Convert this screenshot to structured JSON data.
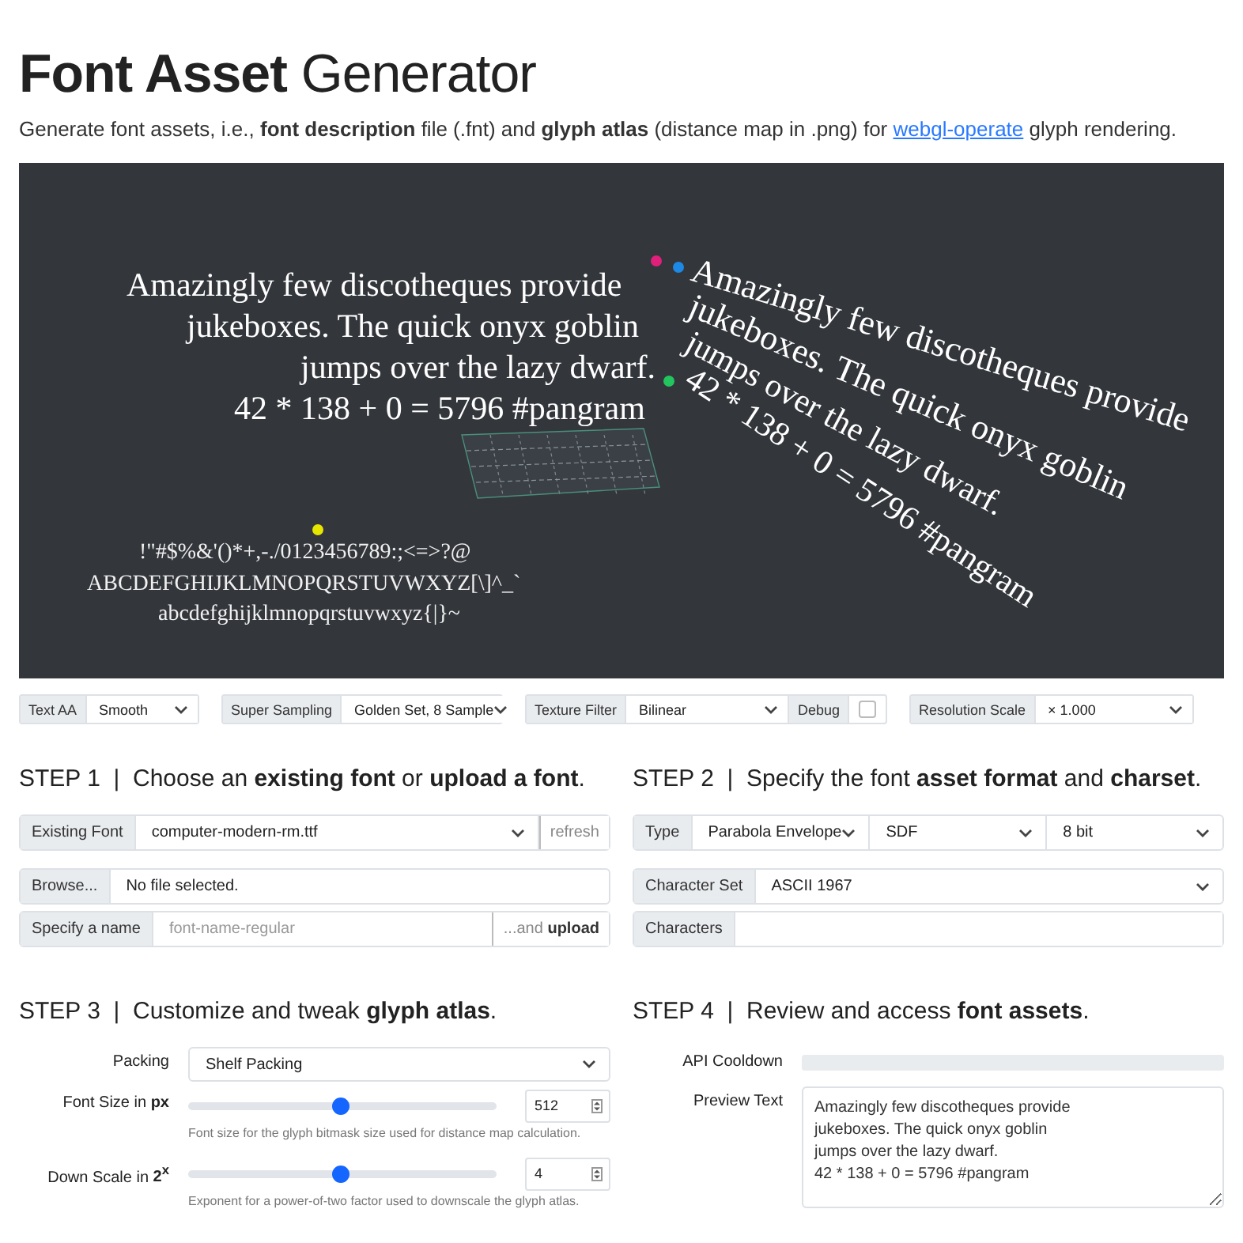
{
  "title": {
    "bold": "Font Asset",
    "light": "Generator"
  },
  "intro": {
    "text": "Generate font assets, i.e., **font description** file (.fnt) and **glyph atlas** (distance map in .png) for",
    "link": "webgl-operate",
    "after": "glyph rendering."
  },
  "render": {
    "left_lines": [
      "Amazingly few discotheques provide",
      "jukeboxes. The quick onyx goblin",
      "jumps over the lazy dwarf.",
      "42 * 138 + 0 = 5796 #pangram"
    ],
    "glyph_lines": [
      "!\"#$%&'()*+,-./0123456789:;<=>?@",
      "ABCDEFGHIJKLMNOPQRSTUVWXYZ[\\]^_`",
      "abcdefghijklmnopqrstuvwxyz{|}~"
    ],
    "right_lines": [
      "Amazingly few discotheques provide",
      "jukeboxes. The quick onyx goblin",
      "jumps over the lazy dwarf.",
      "42 * 138 + 0 = 5796 #pangram"
    ]
  },
  "render_controls": [
    {
      "controls": [
        {
          "kind": "select",
          "label": "Text AA",
          "value": "Smooth"
        }
      ]
    },
    {
      "controls": [
        {
          "kind": "select",
          "label": "Super Sampling",
          "value": "Golden Set, 8 Sample"
        }
      ]
    },
    {
      "controls": [
        {
          "kind": "select",
          "label": "Texture Filter",
          "value": "Bilinear"
        },
        {
          "kind": "checkbox",
          "label": "Debug",
          "checked": false
        }
      ]
    },
    {
      "controls": [
        {
          "kind": "select",
          "label": "Resolution Scale",
          "value": "× 1.000"
        }
      ]
    }
  ],
  "step1": {
    "heading": "STEP 1  |  Choose an **existing font** or **upload a font**.",
    "font_label": "Existing Font",
    "font_value": "computer-modern-rm.ttf",
    "refresh": "refresh",
    "browse": "Browse...",
    "file_status": "No file selected.",
    "name_label": "Specify a name",
    "name_placeholder": "font-name-regular",
    "upload": "...and **upload**"
  },
  "step2": {
    "heading": "STEP 2  |  Specify the font **asset format** and **charset**.",
    "type_label": "Type",
    "type_selects": [
      "Parabola Envelope",
      "SDF",
      "8 bit"
    ],
    "charset_label": "Character Set",
    "charset_value": "ASCII 1967",
    "characters_label": "Characters"
  },
  "step3": {
    "heading": "STEP 3  |  Customize and tweak **glyph atlas**.",
    "packing_label": "Packing",
    "packing_value": "Shelf Packing",
    "sliders": [
      {
        "label": "Font Size in **px**",
        "level": 0.49,
        "value": "512",
        "help": "Font size for the glyph bitmask size used for distance map calculation."
      },
      {
        "label": "Down Scale in **2$^{x}$**",
        "level": 0.49,
        "value": "4",
        "help": "Exponent for a power-of-two factor used to downscale the glyph atlas."
      }
    ]
  },
  "step4": {
    "heading": "STEP 4  |  Review and access **font assets**.",
    "cooldown_label": "API Cooldown",
    "cooldown": {
      "level": 0
    },
    "preview_label": "Preview Text",
    "preview_value": "Amazingly few discotheques provide\njukeboxes. The quick onyx goblin\njumps over the lazy dwarf.\n42 * 138 + 0 = 5796 #pangram"
  }
}
